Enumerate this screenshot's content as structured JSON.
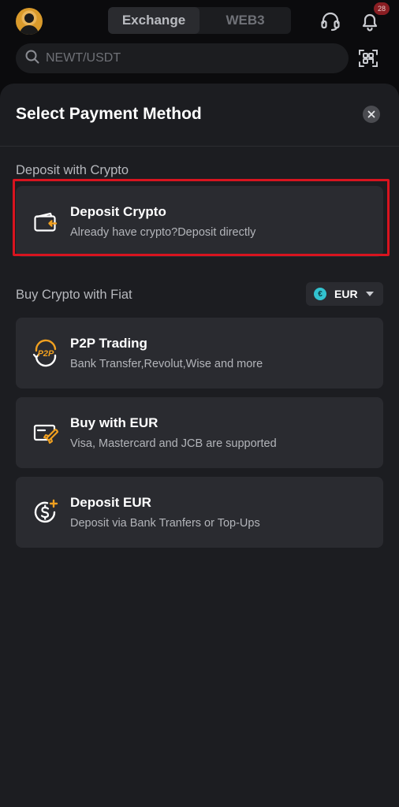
{
  "header": {
    "tabs": [
      {
        "label": "Exchange",
        "active": true
      },
      {
        "label": "WEB3",
        "active": false
      }
    ],
    "notification_count": "28",
    "search_placeholder": "NEWT/USDT",
    "icons": {
      "avatar": "user-avatar",
      "support": "headset-icon",
      "notifications": "bell-icon",
      "scan": "qr-scan-icon",
      "search": "search-icon"
    }
  },
  "sheet": {
    "title": "Select Payment Method",
    "close_icon": "close-icon",
    "crypto_section": {
      "label": "Deposit with Crypto",
      "items": [
        {
          "title": "Deposit Crypto",
          "subtitle": "Already have crypto?Deposit directly",
          "icon": "wallet-deposit-icon"
        }
      ]
    },
    "fiat_section": {
      "label": "Buy Crypto with Fiat",
      "currency": {
        "symbol": "€",
        "code": "EUR"
      },
      "items": [
        {
          "title": "P2P Trading",
          "subtitle": "Bank Transfer,Revolut,Wise and more",
          "icon": "p2p-icon"
        },
        {
          "title": "Buy with EUR",
          "subtitle": "Visa, Mastercard and JCB are supported",
          "icon": "card-rocket-icon"
        },
        {
          "title": "Deposit EUR",
          "subtitle": "Deposit via Bank Tranfers or Top-Ups",
          "icon": "dollar-plus-icon"
        }
      ]
    }
  },
  "colors": {
    "accent": "#f0a020",
    "highlight_border": "#d8141f",
    "sheet_bg": "#1c1d21",
    "card_bg": "#2a2b30"
  }
}
